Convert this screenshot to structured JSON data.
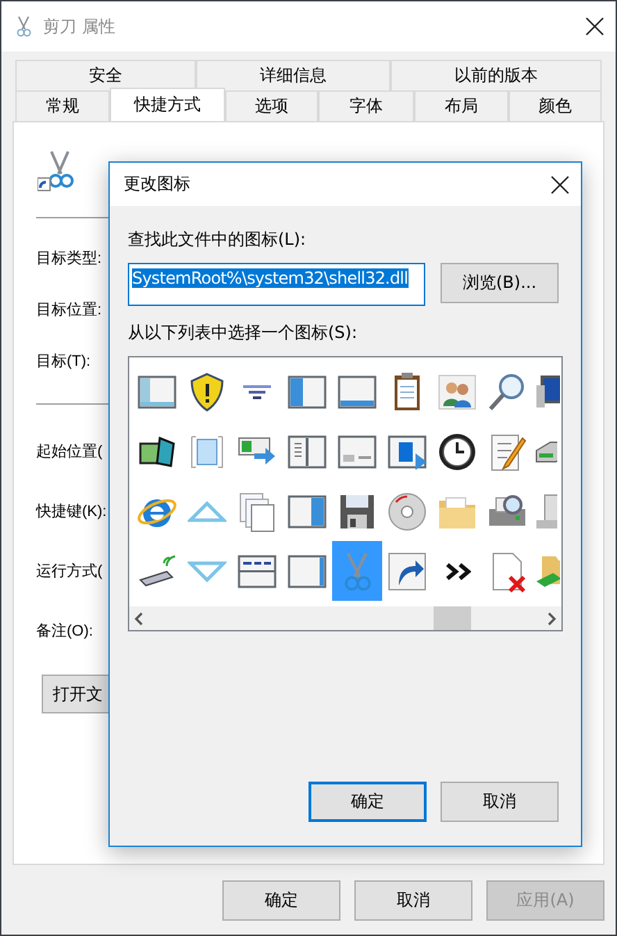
{
  "window": {
    "title": "剪刀 属性"
  },
  "tabs_row_1": [
    {
      "label": "安全",
      "selected": false
    },
    {
      "label": "详细信息",
      "selected": false
    },
    {
      "label": "以前的版本",
      "selected": false
    }
  ],
  "tabs_row_2": [
    {
      "label": "常规",
      "selected": false
    },
    {
      "label": "快捷方式",
      "selected": true
    },
    {
      "label": "选项",
      "selected": false
    },
    {
      "label": "字体",
      "selected": false
    },
    {
      "label": "布局",
      "selected": false
    },
    {
      "label": "颜色",
      "selected": false
    }
  ],
  "target_fields": [
    {
      "label": "目标类型:"
    },
    {
      "label": "目标位置:"
    },
    {
      "label": "目标(T):"
    }
  ],
  "start_fields": [
    {
      "label": "起始位置("
    },
    {
      "label": "快捷键(K):"
    },
    {
      "label": "运行方式("
    },
    {
      "label": "备注(O):"
    }
  ],
  "open_file_button": "打开文",
  "buttons": [
    {
      "label": "确定",
      "disabled": false
    },
    {
      "label": "取消",
      "disabled": false
    },
    {
      "label": "应用(A)",
      "disabled": true
    }
  ],
  "dialog": {
    "title": "更改图标",
    "file_label": "查找此文件中的图标(L):",
    "file_value": "SystemRoot%\\system32\\shell32.dll",
    "browse_button": "浏览(B)...",
    "list_label": "从以下列表中选择一个图标(S):",
    "icons": [
      {
        "selected": false
      },
      {
        "selected": false
      },
      {
        "selected": false
      },
      {
        "selected": false
      },
      {
        "selected": false
      },
      {
        "selected": false
      },
      {
        "selected": false
      },
      {
        "selected": false
      },
      {
        "selected": false
      },
      {
        "selected": false
      },
      {
        "selected": false
      },
      {
        "selected": false
      },
      {
        "selected": false
      },
      {
        "selected": false
      },
      {
        "selected": false
      },
      {
        "selected": false
      },
      {
        "selected": false
      },
      {
        "selected": false
      },
      {
        "selected": false
      },
      {
        "selected": false
      },
      {
        "selected": false
      },
      {
        "selected": false
      },
      {
        "selected": false
      },
      {
        "selected": false
      },
      {
        "selected": false
      },
      {
        "selected": false
      },
      {
        "selected": false
      },
      {
        "selected": false
      },
      {
        "selected": false
      },
      {
        "selected": false
      },
      {
        "selected": false
      },
      {
        "selected": true
      },
      {
        "selected": false
      },
      {
        "selected": false
      },
      {
        "selected": false
      },
      {
        "selected": false
      }
    ],
    "buttons": [
      {
        "label": "确定",
        "default": true
      },
      {
        "label": "取消",
        "default": false
      }
    ]
  }
}
